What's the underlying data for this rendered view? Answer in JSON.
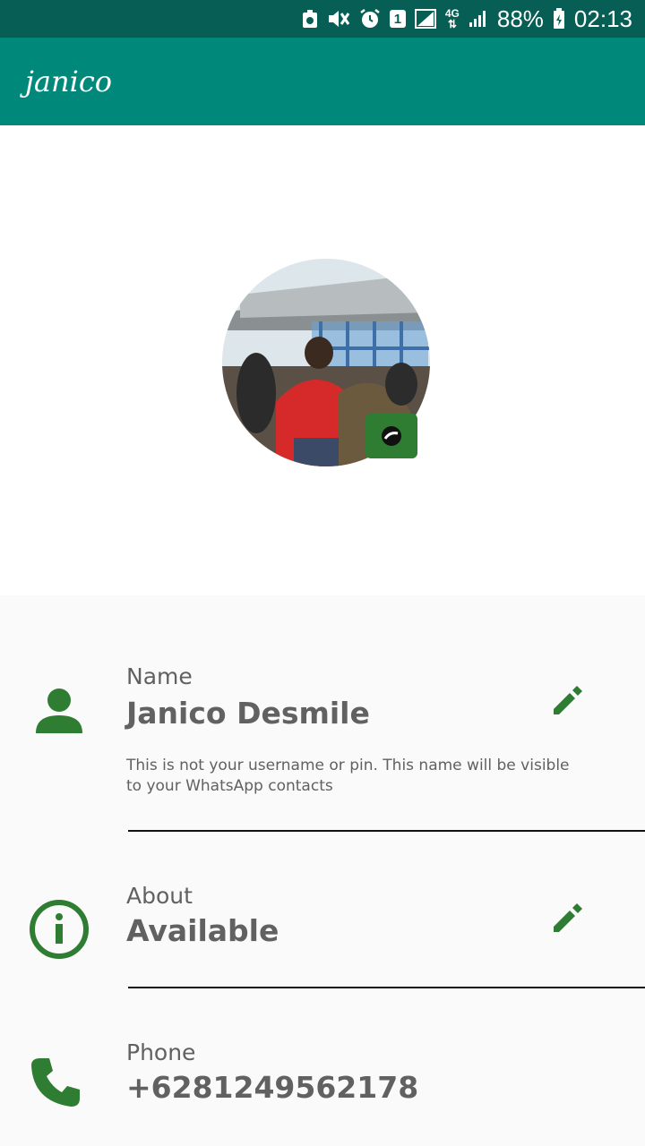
{
  "status_bar": {
    "sim_badge": "1",
    "network_type": "4G",
    "battery_percent": "88%",
    "time": "02:13",
    "icons": [
      "app-notification-icon",
      "mute-icon",
      "alarm-icon",
      "sim-icon",
      "signal-icon",
      "battery-charging-icon"
    ]
  },
  "app_bar": {
    "title": "janico"
  },
  "profile": {
    "photo_icon": "profile-photo",
    "camera_icon": "camera-icon"
  },
  "rows": {
    "name": {
      "label": "Name",
      "value": "Janico Desmile",
      "hint": "This is not your username or pin. This name will be visible to your WhatsApp contacts",
      "icon": "person-icon",
      "edit_icon": "pencil-icon"
    },
    "about": {
      "label": "About",
      "value": "Available",
      "icon": "info-icon",
      "edit_icon": "pencil-icon"
    },
    "phone": {
      "label": "Phone",
      "value": "+6281249562178",
      "icon": "phone-icon"
    }
  },
  "colors": {
    "status_bar": "#075e54",
    "app_bar": "#00897b",
    "icon_green": "#2e7d32",
    "text_gray": "#616161"
  }
}
